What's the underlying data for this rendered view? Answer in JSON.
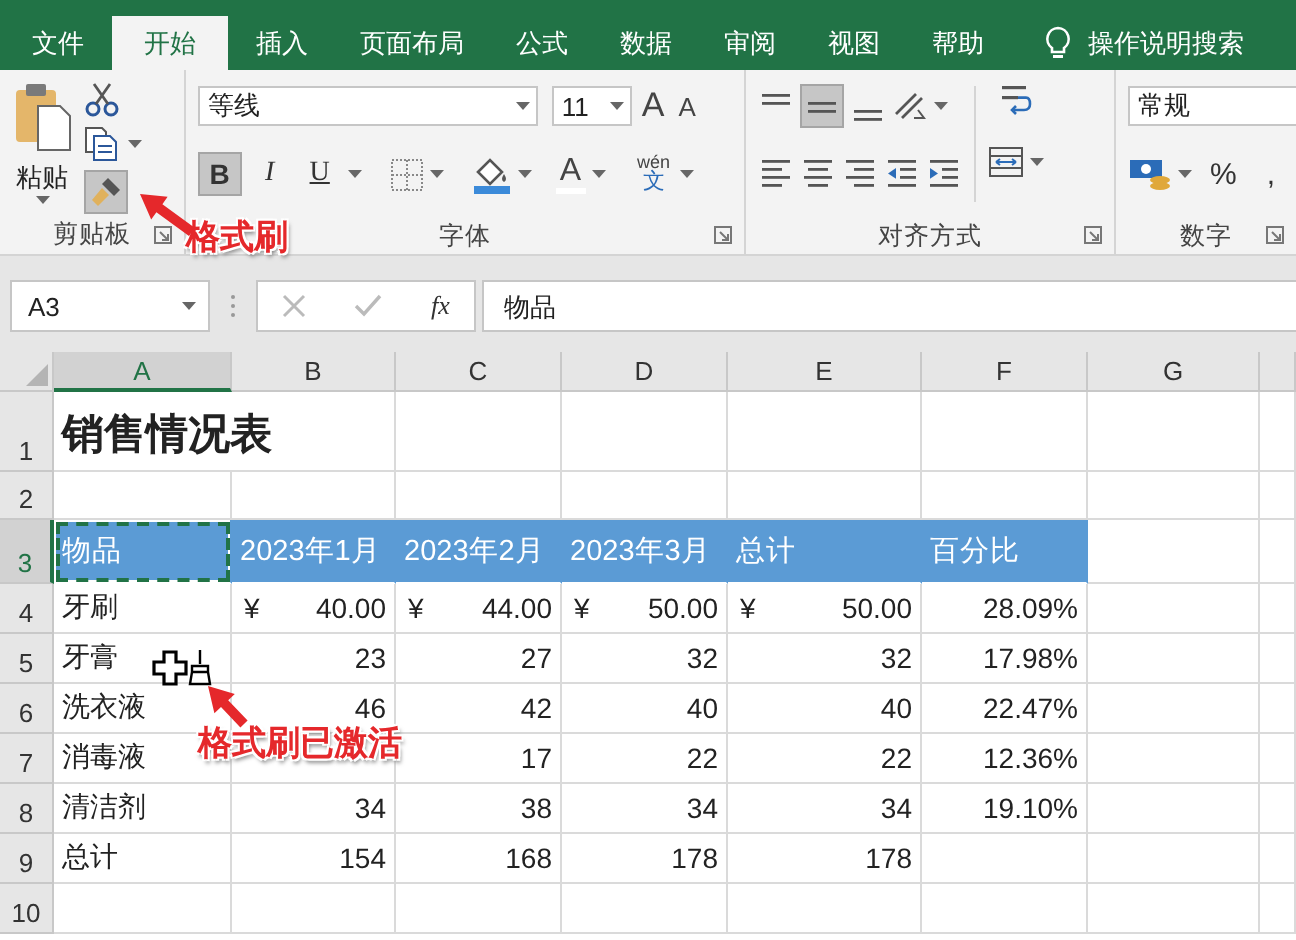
{
  "tabs": [
    {
      "label": "文件",
      "selected": false
    },
    {
      "label": "开始",
      "selected": true
    },
    {
      "label": "插入",
      "selected": false
    },
    {
      "label": "页面布局",
      "selected": false
    },
    {
      "label": "公式",
      "selected": false
    },
    {
      "label": "数据",
      "selected": false
    },
    {
      "label": "审阅",
      "selected": false
    },
    {
      "label": "视图",
      "selected": false
    },
    {
      "label": "帮助",
      "selected": false
    }
  ],
  "tell_me": "操作说明搜索",
  "clipboard": {
    "paste": "粘贴",
    "format_painter_pressed": true,
    "group_label": "剪贴板"
  },
  "font": {
    "font_name": "等线",
    "font_size": "11",
    "grow": "A",
    "shrink": "A",
    "bold": "B",
    "bold_pressed": true,
    "italic": "I",
    "underline": "U",
    "font_color": "A",
    "phonetic_top": "wén",
    "phonetic_bottom": "文",
    "group_label": "字体"
  },
  "alignment": {
    "middle_pressed": true,
    "group_label": "对齐方式"
  },
  "number": {
    "format": "常规",
    "percent": "%",
    "comma": ",",
    "group_label": "数字"
  },
  "formula_bar": {
    "name_box": "A3",
    "fx": "fx",
    "formula": "物品"
  },
  "columns": [
    {
      "label": "A",
      "selected": true
    },
    {
      "label": "B",
      "selected": false
    },
    {
      "label": "C",
      "selected": false
    },
    {
      "label": "D",
      "selected": false
    },
    {
      "label": "E",
      "selected": false
    },
    {
      "label": "F",
      "selected": false
    },
    {
      "label": "G",
      "selected": false
    }
  ],
  "rows": [
    {
      "number": "1",
      "selected": false,
      "cells": [
        {
          "kind": "title",
          "text": "销售情况表",
          "selected": false
        },
        {
          "selected": false
        },
        {
          "selected": false
        },
        {
          "selected": false
        },
        {
          "selected": false
        },
        {
          "selected": false
        }
      ]
    },
    {
      "number": "2",
      "selected": false,
      "cells": [
        {
          "selected": false
        },
        {
          "selected": false
        },
        {
          "selected": false
        },
        {
          "selected": false
        },
        {
          "selected": false
        },
        {
          "selected": false
        },
        {
          "selected": false
        }
      ]
    },
    {
      "number": "3",
      "selected": true,
      "cells": [
        {
          "kind": "header",
          "text": "物品",
          "selected": true
        },
        {
          "kind": "header",
          "text": "2023年1月",
          "selected": false
        },
        {
          "kind": "header",
          "text": "2023年2月",
          "selected": false
        },
        {
          "kind": "header",
          "text": "2023年3月",
          "selected": false
        },
        {
          "kind": "header",
          "text": "总计",
          "selected": false
        },
        {
          "kind": "header",
          "text": "百分比",
          "selected": false
        },
        {
          "selected": false
        }
      ]
    },
    {
      "number": "4",
      "selected": false,
      "cells": [
        {
          "kind": "text",
          "text": "牙刷",
          "selected": false
        },
        {
          "kind": "currency",
          "symbol": "¥",
          "text": "40.00",
          "selected": false
        },
        {
          "kind": "currency",
          "symbol": "¥",
          "text": "44.00",
          "selected": false
        },
        {
          "kind": "currency",
          "symbol": "¥",
          "text": "50.00",
          "selected": false
        },
        {
          "kind": "currency",
          "symbol": "¥",
          "text": "50.00",
          "selected": false
        },
        {
          "kind": "number",
          "text": "28.09%",
          "selected": false
        },
        {
          "selected": false
        }
      ]
    },
    {
      "number": "5",
      "selected": false,
      "cells": [
        {
          "kind": "text",
          "text": "牙膏",
          "selected": false
        },
        {
          "kind": "number",
          "text": "23",
          "selected": false
        },
        {
          "kind": "number",
          "text": "27",
          "selected": false
        },
        {
          "kind": "number",
          "text": "32",
          "selected": false
        },
        {
          "kind": "number",
          "text": "32",
          "selected": false
        },
        {
          "kind": "number",
          "text": "17.98%",
          "selected": false
        },
        {
          "selected": false
        }
      ]
    },
    {
      "number": "6",
      "selected": false,
      "cells": [
        {
          "kind": "text",
          "text": "洗衣液",
          "selected": false
        },
        {
          "kind": "number",
          "text": "46",
          "selected": false
        },
        {
          "kind": "number",
          "text": "42",
          "selected": false
        },
        {
          "kind": "number",
          "text": "40",
          "selected": false
        },
        {
          "kind": "number",
          "text": "40",
          "selected": false
        },
        {
          "kind": "number",
          "text": "22.47%",
          "selected": false
        },
        {
          "selected": false
        }
      ]
    },
    {
      "number": "7",
      "selected": false,
      "cells": [
        {
          "kind": "text",
          "text": "消毒液",
          "selected": false
        },
        {
          "selected": false
        },
        {
          "kind": "number",
          "text": "17",
          "selected": false
        },
        {
          "kind": "number",
          "text": "22",
          "selected": false
        },
        {
          "kind": "number",
          "text": "22",
          "selected": false
        },
        {
          "kind": "number",
          "text": "12.36%",
          "selected": false
        },
        {
          "selected": false
        }
      ]
    },
    {
      "number": "8",
      "selected": false,
      "cells": [
        {
          "kind": "text",
          "text": "清洁剂",
          "selected": false
        },
        {
          "kind": "number",
          "text": "34",
          "selected": false
        },
        {
          "kind": "number",
          "text": "38",
          "selected": false
        },
        {
          "kind": "number",
          "text": "34",
          "selected": false
        },
        {
          "kind": "number",
          "text": "34",
          "selected": false
        },
        {
          "kind": "number",
          "text": "19.10%",
          "selected": false
        },
        {
          "selected": false
        }
      ]
    },
    {
      "number": "9",
      "selected": false,
      "cells": [
        {
          "kind": "text",
          "text": "总计",
          "selected": false
        },
        {
          "kind": "number",
          "text": "154",
          "selected": false
        },
        {
          "kind": "number",
          "text": "168",
          "selected": false
        },
        {
          "kind": "number",
          "text": "178",
          "selected": false
        },
        {
          "kind": "number",
          "text": "178",
          "selected": false
        },
        {
          "selected": false
        },
        {
          "selected": false
        }
      ]
    },
    {
      "number": "10",
      "selected": false,
      "cells": [
        {
          "selected": false
        },
        {
          "selected": false
        },
        {
          "selected": false
        },
        {
          "selected": false
        },
        {
          "selected": false
        },
        {
          "selected": false
        },
        {
          "selected": false
        }
      ]
    }
  ],
  "callouts": [
    {
      "text": "格式刷"
    },
    {
      "text": "格式刷已激活"
    }
  ]
}
